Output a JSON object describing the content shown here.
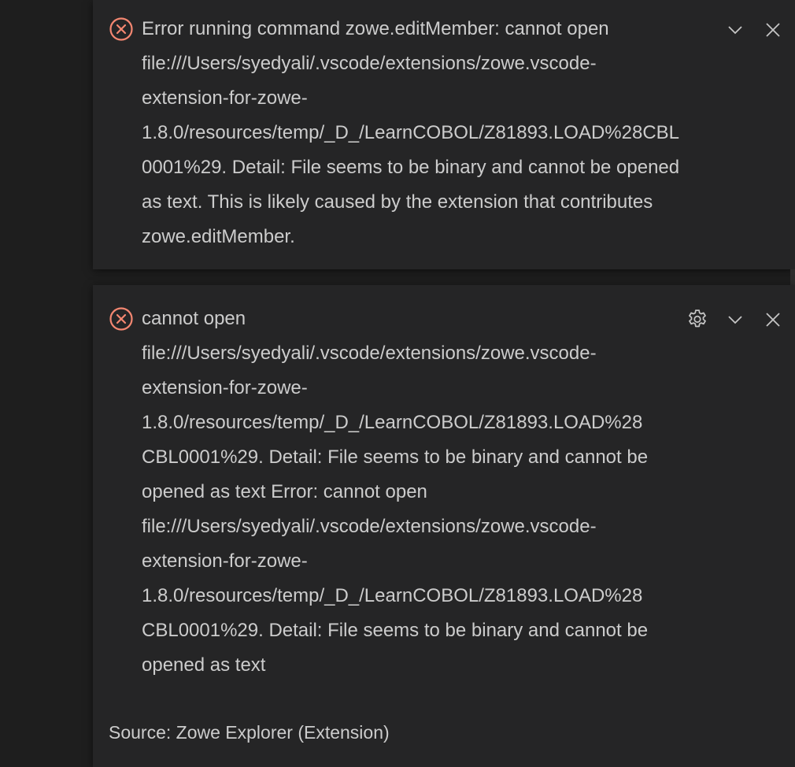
{
  "notifications": [
    {
      "severity": "error",
      "icon": "error-circle-icon",
      "message": "Error running command zowe.editMember: cannot open\nfile:///Users/syedyali/.vscode/extensions/zowe.vscode-\nextension-for-zowe-\n1.8.0/resources/temp/_D_/LearnCOBOL/Z81893.LOAD%28CBL\n0001%29. Detail: File seems to be binary and cannot be opened\nas text. This is likely caused by the extension that contributes\nzowe.editMember.",
      "actions": [
        "chevron-down-icon",
        "close-icon"
      ]
    },
    {
      "severity": "error",
      "icon": "error-circle-icon",
      "message": "cannot open\nfile:///Users/syedyali/.vscode/extensions/zowe.vscode-\nextension-for-zowe-\n1.8.0/resources/temp/_D_/LearnCOBOL/Z81893.LOAD%28\nCBL0001%29. Detail: File seems to be binary and cannot be\nopened as text Error: cannot open\nfile:///Users/syedyali/.vscode/extensions/zowe.vscode-\nextension-for-zowe-\n1.8.0/resources/temp/_D_/LearnCOBOL/Z81893.LOAD%28\nCBL0001%29. Detail: File seems to be binary and cannot be\nopened as text",
      "source": "Source: Zowe Explorer (Extension)",
      "actions": [
        "gear-icon",
        "chevron-down-icon",
        "close-icon"
      ]
    }
  ],
  "colors": {
    "background": "#1e1e1e",
    "toast_background": "#252526",
    "text": "#cccccc",
    "error": "#f48771",
    "icon": "#c5c5c5"
  }
}
